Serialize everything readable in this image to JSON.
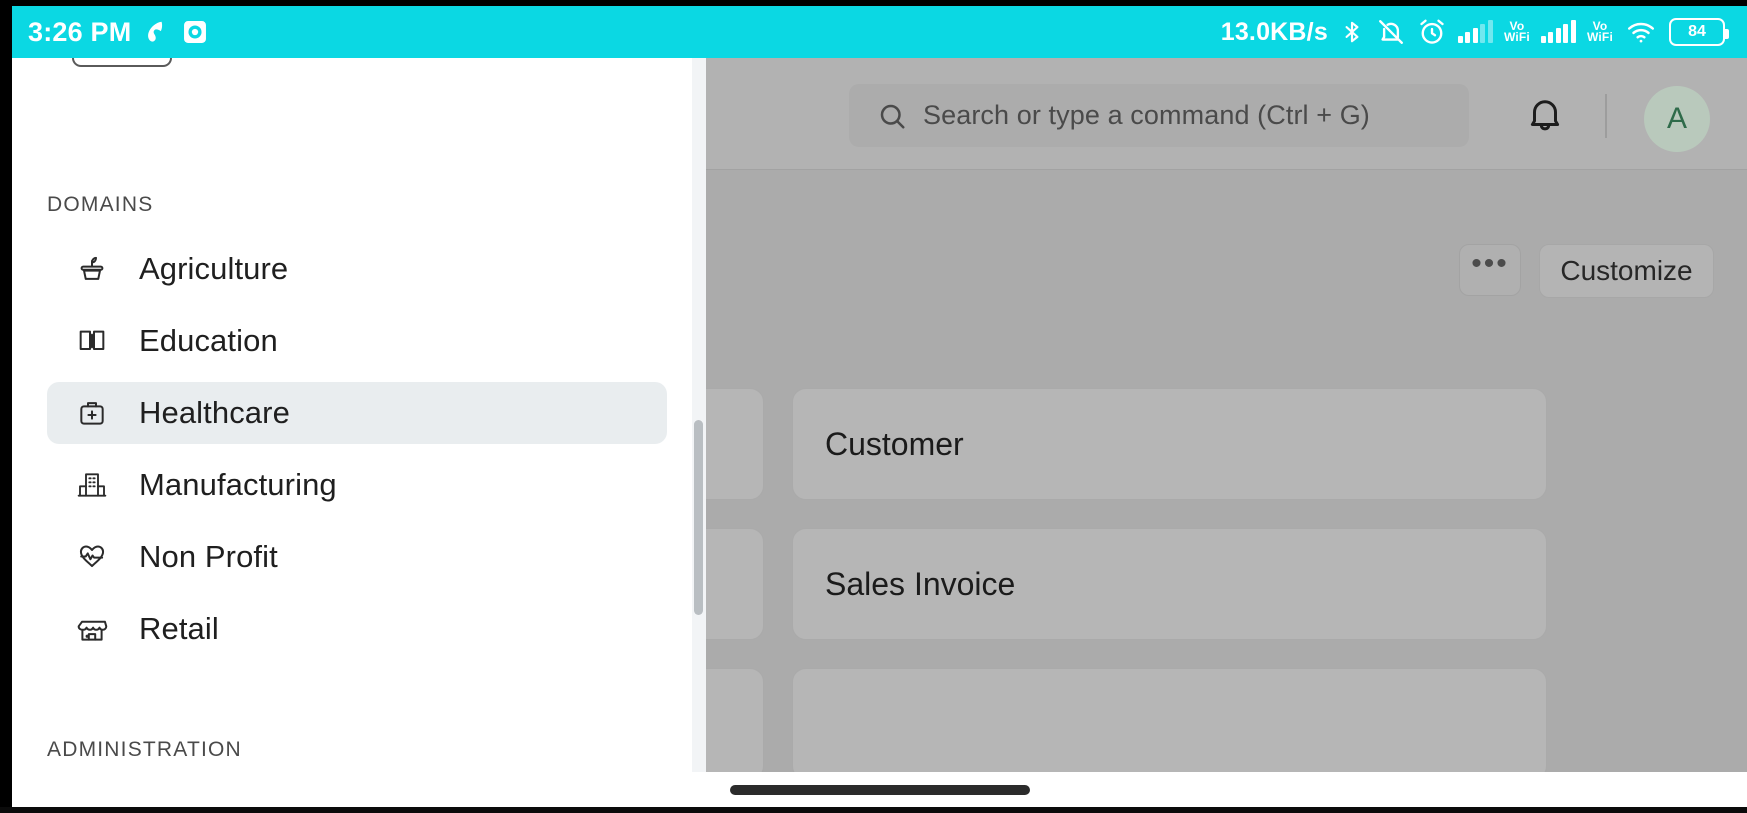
{
  "statusbar": {
    "time": "3:26 PM",
    "network_rate": "13.0KB/s",
    "battery_level": "84",
    "icons": [
      {
        "name": "data-saver-icon",
        "label": "data-saver"
      },
      {
        "name": "screen-recorder-icon",
        "label": "screen-recorder"
      },
      {
        "name": "bluetooth-icon",
        "label": "bluetooth"
      },
      {
        "name": "mute-vibrate-icon",
        "label": "ringer-muted"
      },
      {
        "name": "alarm-icon",
        "label": "alarm"
      },
      {
        "name": "signal-bars-sim1-icon",
        "label": "signal-sim-1"
      },
      {
        "name": "volte-wifi-sim1-icon",
        "label": "VoWiFi"
      },
      {
        "name": "signal-bars-sim2-icon",
        "label": "signal-sim-2"
      },
      {
        "name": "volte-wifi-sim2-icon",
        "label": "VoWiFi"
      },
      {
        "name": "wifi-icon",
        "label": "wifi"
      },
      {
        "name": "battery-icon",
        "label": "battery"
      }
    ],
    "vowifi_label_top": "Vo",
    "vowifi_label_bottom": "WiFi"
  },
  "topbar": {
    "search_placeholder": "Search or type a command (Ctrl + G)",
    "avatar_initial": "A"
  },
  "actions": {
    "ellipsis_label": "•••",
    "customize_label": "Customize"
  },
  "cards": [
    {
      "left_title": "",
      "right_title": "Customer"
    },
    {
      "left_title": "",
      "right_title": "Sales Invoice"
    }
  ],
  "drawer": {
    "section_domains": "DOMAINS",
    "section_administration": "ADMINISTRATION",
    "items": [
      {
        "label": "Agriculture",
        "icon": "plant-pot-icon",
        "active": false
      },
      {
        "label": "Education",
        "icon": "open-book-icon",
        "active": false
      },
      {
        "label": "Healthcare",
        "icon": "medical-bag-icon",
        "active": true
      },
      {
        "label": "Manufacturing",
        "icon": "factory-icon",
        "active": false
      },
      {
        "label": "Non Profit",
        "icon": "heart-pulse-icon",
        "active": false
      },
      {
        "label": "Retail",
        "icon": "storefront-icon",
        "active": false
      }
    ]
  },
  "colors": {
    "statusbar_bg": "#0BD8E3",
    "overlay_dim": "#ABABAB",
    "active_item_bg": "#E9EDEF",
    "avatar_bg": "#B9C9BC",
    "avatar_fg": "#2F6B4A"
  }
}
